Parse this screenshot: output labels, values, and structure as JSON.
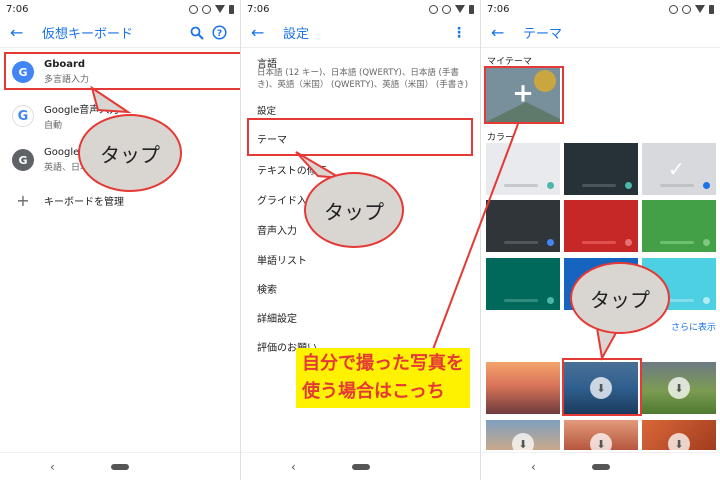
{
  "status": {
    "time": "7:06"
  },
  "panel1": {
    "title": "仮想キーボード",
    "items": [
      {
        "name": "Gboard",
        "sub": "多言語入力",
        "icon": "G"
      },
      {
        "name": "Google音声入力",
        "sub": "自動",
        "icon": "G"
      },
      {
        "name": "Google",
        "sub": "英語、日本語",
        "icon": "G"
      }
    ],
    "add_keyboard": "キーボードを管理"
  },
  "panel2": {
    "title": "設定",
    "language_label": "言語",
    "language_value": "日本語 (12 キー)、日本語 (QWERTY)、日本語 (手書き)、英語（米国） (QWERTY)、英語（米国） (手書き)",
    "section_label": "設定",
    "items": [
      "テーマ",
      "テキストの修正",
      "グライド入力",
      "音声入力",
      "単語リスト",
      "検索",
      "詳細設定",
      "評価のお願い"
    ]
  },
  "panel3": {
    "title": "テーマ",
    "my_theme_label": "マイテーマ",
    "color_label": "カラー",
    "more_link": "さらに表示"
  },
  "callouts": {
    "tap1": "タップ",
    "tap2": "タップ",
    "tap3": "タップ",
    "note_line1": "自分で撮った写真を",
    "note_line2": "使う場合はこっち"
  },
  "colors": {
    "accent": "#1a73e8",
    "highlight": "#e53935",
    "note_bg": "#fff200"
  }
}
